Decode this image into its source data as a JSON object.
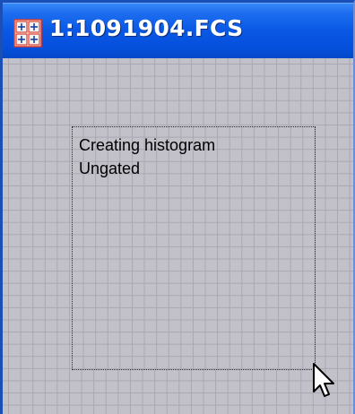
{
  "window": {
    "title": "1:1091904.FCS",
    "title_icon": "fcs-document-icon",
    "colors": {
      "titlebar": "#0a58e4",
      "border": "#1a4fb8",
      "client_background": "#c2c0c8",
      "grid_line": "#a9a7b0",
      "text": "#000000"
    }
  },
  "plot_area": {
    "status_lines": [
      "Creating histogram",
      "Ungated"
    ]
  },
  "cursor": {
    "icon": "mouse-pointer-icon"
  }
}
